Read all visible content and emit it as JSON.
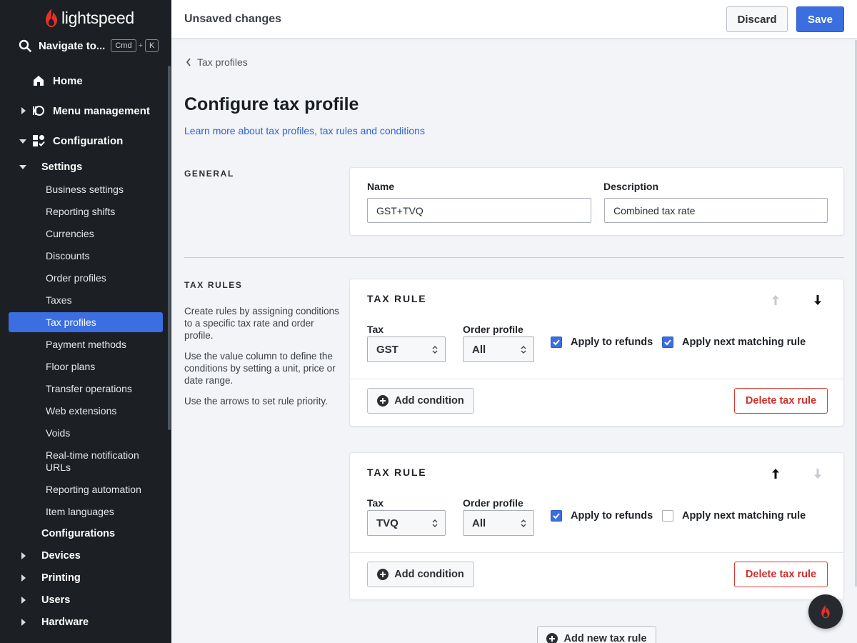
{
  "brand": {
    "name": "lightspeed",
    "accent": "#e4322b"
  },
  "sidebar": {
    "navigate": {
      "label": "Navigate to...",
      "key1": "Cmd",
      "plus": "+",
      "key2": "K"
    },
    "home": "Home",
    "menu_management": "Menu management",
    "configuration": "Configuration",
    "settings": "Settings",
    "settings_items": [
      "Business settings",
      "Reporting shifts",
      "Currencies",
      "Discounts",
      "Order profiles",
      "Taxes",
      "Tax profiles",
      "Payment methods",
      "Floor plans",
      "Transfer operations",
      "Web extensions",
      "Voids",
      "Real-time notification URLs",
      "Reporting automation",
      "Item languages"
    ],
    "configurations": "Configurations",
    "bottom_items": [
      "Devices",
      "Printing",
      "Users",
      "Hardware"
    ],
    "active_item": "Tax profiles"
  },
  "header": {
    "title": "Unsaved changes",
    "discard": "Discard",
    "save": "Save"
  },
  "main": {
    "back_link": "Tax profiles",
    "title": "Configure tax profile",
    "learn_link": "Learn more about tax profiles, tax rules and conditions",
    "general": {
      "section_label": "GENERAL",
      "name_label": "Name",
      "name_value": "GST+TVQ",
      "description_label": "Description",
      "description_value": "Combined tax rate"
    },
    "tax_rules": {
      "section_label": "TAX RULES",
      "help": [
        "Create rules by assigning conditions to a specific tax rate and order profile.",
        "Use the value column to define the conditions by setting a unit, price or date range.",
        "Use the arrows to set rule priority."
      ],
      "rules": [
        {
          "title": "TAX RULE",
          "tax_label": "Tax",
          "tax_value": "GST",
          "order_profile_label": "Order profile",
          "order_profile_value": "All",
          "apply_refunds_label": "Apply to refunds",
          "apply_refunds_checked": true,
          "apply_next_label": "Apply next matching rule",
          "apply_next_checked": true,
          "add_condition": "Add condition",
          "delete": "Delete tax rule"
        },
        {
          "title": "TAX RULE",
          "tax_label": "Tax",
          "tax_value": "TVQ",
          "order_profile_label": "Order profile",
          "order_profile_value": "All",
          "apply_refunds_label": "Apply to refunds",
          "apply_refunds_checked": true,
          "apply_next_label": "Apply next matching rule",
          "apply_next_checked": false,
          "add_condition": "Add condition",
          "delete": "Delete tax rule"
        }
      ],
      "add_new": "Add new tax rule"
    }
  }
}
